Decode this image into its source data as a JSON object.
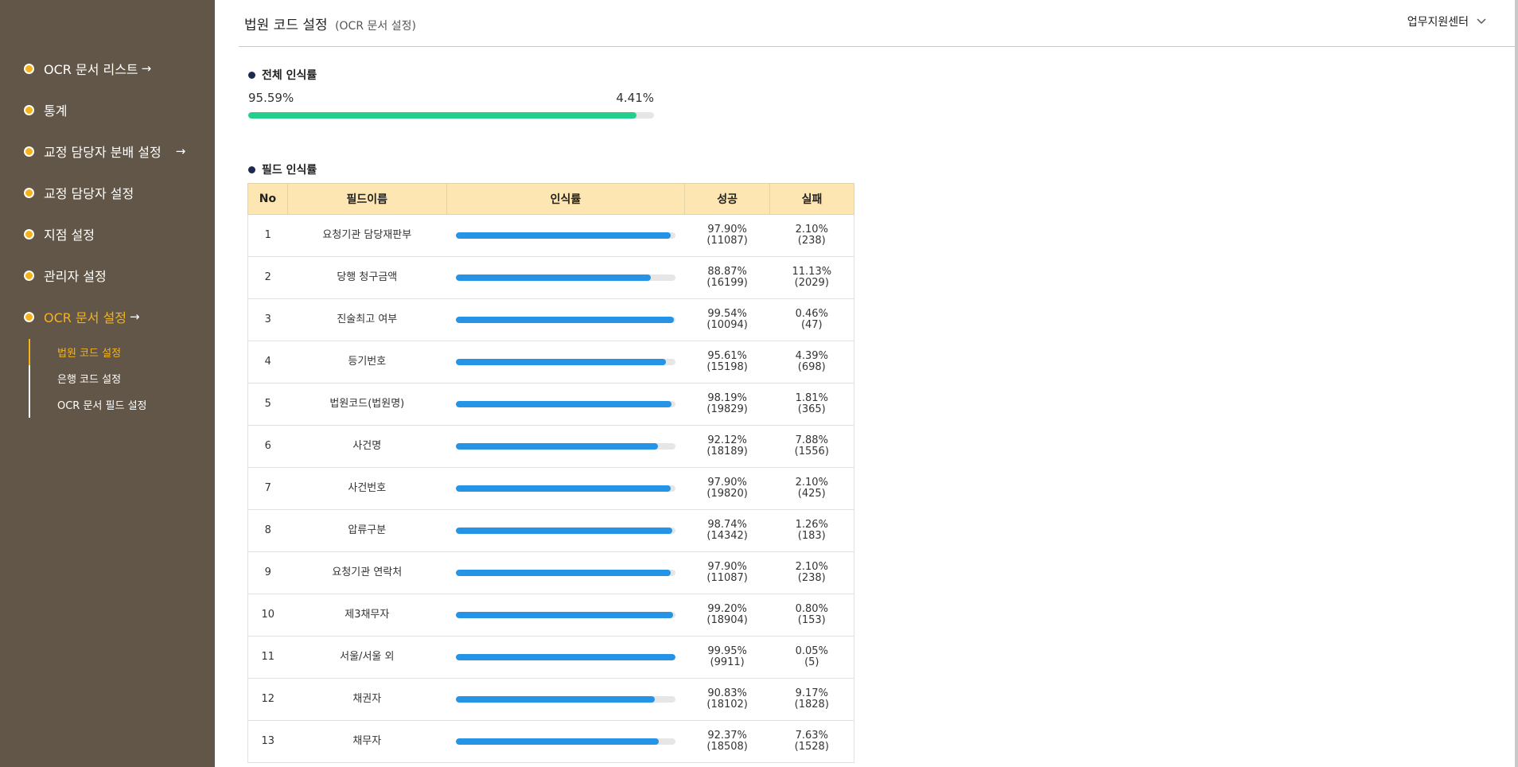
{
  "sidebar": {
    "items": [
      {
        "label": "OCR 문서 리스트",
        "arrow": "→"
      },
      {
        "label": "통계"
      },
      {
        "label": "교정 담당자 분배 설정",
        "arrow": "→"
      },
      {
        "label": "교정 담당자 설정"
      },
      {
        "label": "지점 설정"
      },
      {
        "label": "관리자 설정"
      },
      {
        "label": "OCR 문서 설정",
        "arrow": "→",
        "active": true
      }
    ],
    "subitems": [
      {
        "label": "법원 코드 설정",
        "active": true
      },
      {
        "label": "은행 코드 설정"
      },
      {
        "label": "OCR 문서 필드 설정"
      }
    ]
  },
  "header": {
    "title": "법원 코드 설정",
    "subtitle": "(OCR 문서 설정)",
    "support": "업무지원센터",
    "support_icon": "chevron-down-icon"
  },
  "overall": {
    "title": "전체 인식률",
    "success_label": "95.59%",
    "fail_label": "4.41%",
    "success_fraction": 0.9559,
    "bar_color": "#24cf8d"
  },
  "fields": {
    "title": "필드 인식률",
    "columns": [
      "No",
      "필드이름",
      "인식률",
      "성공",
      "실패"
    ],
    "bar_color": "#2593e6",
    "rows": [
      {
        "no": "1",
        "name": "요청기관 담당재판부",
        "success_pct": "97.90%",
        "success_count": "(11087)",
        "fail_pct": "2.10%",
        "fail_count": "(238)",
        "rate": 0.979
      },
      {
        "no": "2",
        "name": "당행 청구금액",
        "success_pct": "88.87%",
        "success_count": "(16199)",
        "fail_pct": "11.13%",
        "fail_count": "(2029)",
        "rate": 0.8887
      },
      {
        "no": "3",
        "name": "진술최고 여부",
        "success_pct": "99.54%",
        "success_count": "(10094)",
        "fail_pct": "0.46%",
        "fail_count": "(47)",
        "rate": 0.9954
      },
      {
        "no": "4",
        "name": "등기번호",
        "success_pct": "95.61%",
        "success_count": "(15198)",
        "fail_pct": "4.39%",
        "fail_count": "(698)",
        "rate": 0.9561
      },
      {
        "no": "5",
        "name": "법원코드(법원명)",
        "success_pct": "98.19%",
        "success_count": "(19829)",
        "fail_pct": "1.81%",
        "fail_count": "(365)",
        "rate": 0.9819
      },
      {
        "no": "6",
        "name": "사건명",
        "success_pct": "92.12%",
        "success_count": "(18189)",
        "fail_pct": "7.88%",
        "fail_count": "(1556)",
        "rate": 0.9212
      },
      {
        "no": "7",
        "name": "사건번호",
        "success_pct": "97.90%",
        "success_count": "(19820)",
        "fail_pct": "2.10%",
        "fail_count": "(425)",
        "rate": 0.979
      },
      {
        "no": "8",
        "name": "압류구분",
        "success_pct": "98.74%",
        "success_count": "(14342)",
        "fail_pct": "1.26%",
        "fail_count": "(183)",
        "rate": 0.9874
      },
      {
        "no": "9",
        "name": "요청기관 연락처",
        "success_pct": "97.90%",
        "success_count": "(11087)",
        "fail_pct": "2.10%",
        "fail_count": "(238)",
        "rate": 0.979
      },
      {
        "no": "10",
        "name": "제3채무자",
        "success_pct": "99.20%",
        "success_count": "(18904)",
        "fail_pct": "0.80%",
        "fail_count": "(153)",
        "rate": 0.992
      },
      {
        "no": "11",
        "name": "서울/서울 외",
        "success_pct": "99.95%",
        "success_count": "(9911)",
        "fail_pct": "0.05%",
        "fail_count": "(5)",
        "rate": 0.9995
      },
      {
        "no": "12",
        "name": "채권자",
        "success_pct": "90.83%",
        "success_count": "(18102)",
        "fail_pct": "9.17%",
        "fail_count": "(1828)",
        "rate": 0.9083
      },
      {
        "no": "13",
        "name": "채무자",
        "success_pct": "92.37%",
        "success_count": "(18508)",
        "fail_pct": "7.63%",
        "fail_count": "(1528)",
        "rate": 0.9237
      }
    ]
  }
}
